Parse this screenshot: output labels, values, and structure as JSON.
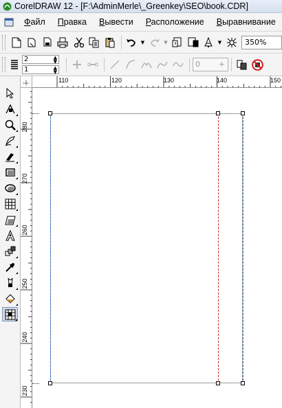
{
  "window": {
    "title": "CorelDRAW 12 - [F:\\AdminMerle\\_Greenkey\\SEO\\book.CDR]"
  },
  "menu": {
    "items": [
      {
        "underline": "Ф",
        "rest": "айл"
      },
      {
        "underline": "П",
        "rest": "равка"
      },
      {
        "underline": "В",
        "rest": "ывести"
      },
      {
        "underline": "Р",
        "rest": "асположение"
      },
      {
        "underline": "В",
        "rest": "ыравнивание"
      }
    ]
  },
  "toolbar": {
    "zoom": "350%"
  },
  "property_bar": {
    "spin_top": "2",
    "spin_bottom": "1",
    "nodes_value": "0"
  },
  "rulers": {
    "horizontal": [
      "110",
      "120",
      "130",
      "140",
      "150"
    ],
    "vertical": [
      "280",
      "270",
      "260",
      "250",
      "240",
      "230"
    ]
  },
  "colors": {
    "guide_blue": "#2f6fd0",
    "guide_red": "#d02020",
    "active_tool": "#cfd9ea"
  }
}
